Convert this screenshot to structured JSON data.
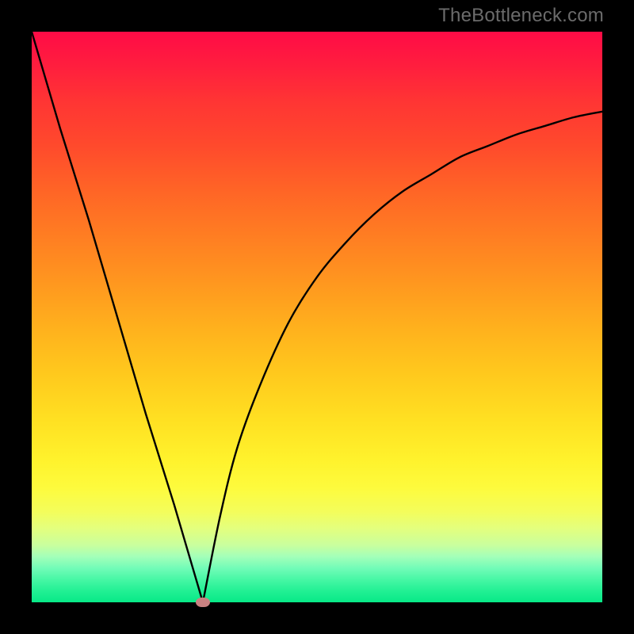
{
  "watermark": "TheBottleneck.com",
  "colors": {
    "frame": "#000000",
    "curve": "#000000",
    "marker": "#c98181",
    "gradient_top": "#ff0b46",
    "gradient_bottom": "#07e987"
  },
  "chart_data": {
    "type": "line",
    "title": "",
    "xlabel": "",
    "ylabel": "",
    "xlim": [
      0,
      100
    ],
    "ylim": [
      0,
      100
    ],
    "grid": false,
    "description": "V-shaped bottleneck curve. Left branch is a steep near-linear descent from top-left to the minimum. Right branch rises from the minimum with decreasing slope (concave), asymptoting toward the upper right.",
    "minimum": {
      "x": 30,
      "y": 0
    },
    "series": [
      {
        "name": "left-branch",
        "x": [
          0,
          5,
          10,
          15,
          20,
          25,
          30
        ],
        "values": [
          100,
          83,
          67,
          50,
          33,
          17,
          0
        ]
      },
      {
        "name": "right-branch",
        "x": [
          30,
          33,
          36,
          40,
          45,
          50,
          55,
          60,
          65,
          70,
          75,
          80,
          85,
          90,
          95,
          100
        ],
        "values": [
          0,
          15,
          27,
          38,
          49,
          57,
          63,
          68,
          72,
          75,
          78,
          80,
          82,
          83.5,
          85,
          86
        ]
      }
    ],
    "marker": {
      "x": 30,
      "y": 0,
      "label": ""
    }
  }
}
